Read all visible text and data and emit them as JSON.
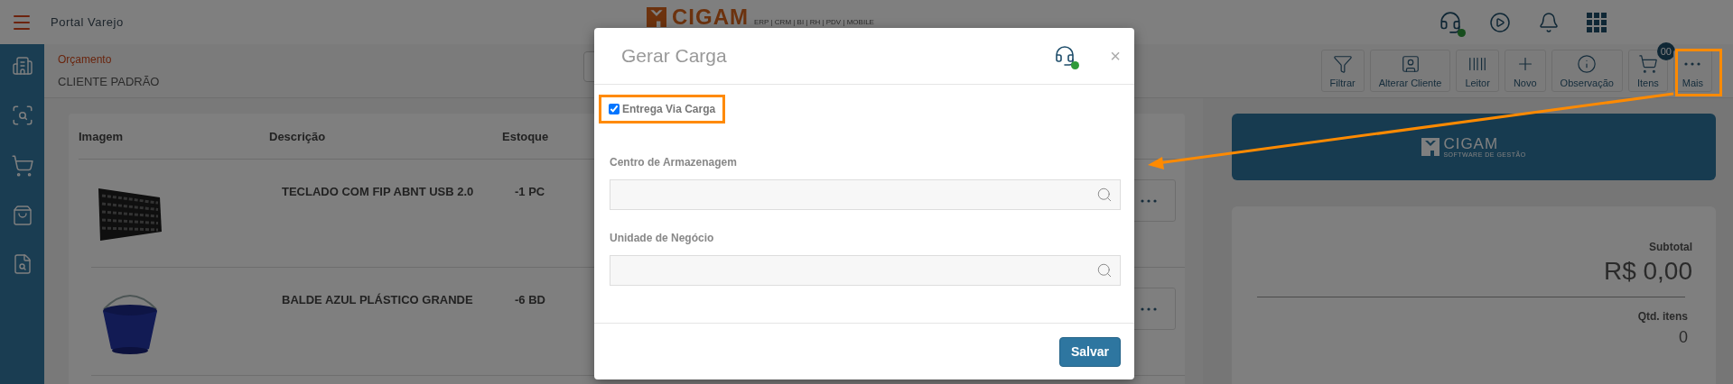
{
  "header": {
    "title": "Portal Varejo",
    "logo": {
      "name": "CIGAM",
      "tagline": "ERP | CRM | BI | RH | PDV | MOBILE"
    }
  },
  "subheader": {
    "breadcrumb": "Orçamento",
    "client": "CLIENTE PADRÃO"
  },
  "toolbar": [
    {
      "kind": "filter",
      "label": "Filtrar"
    },
    {
      "kind": "client",
      "label": "Alterar Cliente"
    },
    {
      "kind": "reader",
      "label": "Leitor"
    },
    {
      "kind": "new",
      "label": "Novo"
    },
    {
      "kind": "note",
      "label": "Observação"
    },
    {
      "kind": "cart",
      "label": "Itens",
      "badge": "00"
    },
    {
      "kind": "more",
      "label": "Mais"
    }
  ],
  "table": {
    "columns": [
      "Imagem",
      "Descrição",
      "Estoque"
    ],
    "rows": [
      {
        "description": "TECLADO COM FIP ABNT USB 2.0",
        "stock": "-1 PC"
      },
      {
        "description": "BALDE AZUL PLÁSTICO GRANDE",
        "stock": "-6 BD"
      }
    ]
  },
  "brand_card": {
    "name": "CIGAM",
    "tagline": "SOFTWARE DE GESTÃO"
  },
  "summary": {
    "subtotal_label": "Subtotal",
    "subtotal": "R$ 0,00",
    "count_label": "Qtd. itens",
    "count": "0"
  },
  "modal": {
    "title": "Gerar Carga",
    "close": "×",
    "checkbox": {
      "label": "Entrega Via Carga",
      "checked": true
    },
    "fields": [
      {
        "label": "Centro de Armazenagem"
      },
      {
        "label": "Unidade de Negócio"
      }
    ],
    "button": "Salvar"
  }
}
